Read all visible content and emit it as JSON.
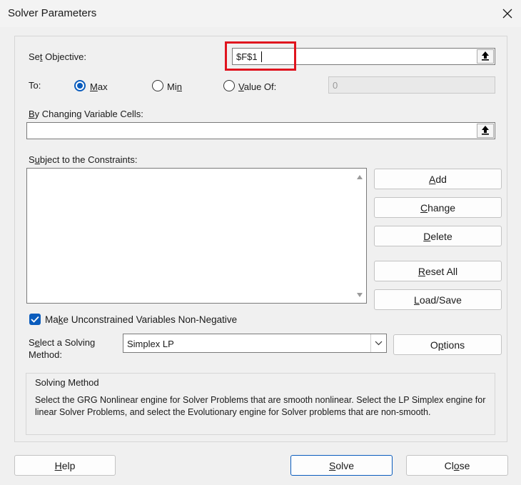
{
  "window": {
    "title": "Solver Parameters"
  },
  "objective": {
    "label": "Set Objective:",
    "value": "$F$1"
  },
  "to": {
    "label": "To:",
    "options": [
      {
        "label": "Max",
        "selected": true
      },
      {
        "label": "Min",
        "selected": false
      },
      {
        "label": "Value Of:",
        "selected": false
      }
    ],
    "value_of": "0"
  },
  "variables": {
    "label": "By Changing Variable Cells:",
    "value": ""
  },
  "constraints": {
    "label": "Subject to the Constraints:",
    "items": [],
    "buttons": {
      "add": "Add",
      "change": "Change",
      "delete": "Delete",
      "reset_all": "Reset All",
      "load_save": "Load/Save"
    }
  },
  "nonneg": {
    "label": "Make Unconstrained Variables Non-Negative",
    "checked": true
  },
  "method": {
    "label_line1": "Select a Solving",
    "label_line2": "Method:",
    "selected": "Simplex LP",
    "options_button": "Options"
  },
  "description": {
    "heading": "Solving Method",
    "text": "Select the GRG Nonlinear engine for Solver Problems that are smooth nonlinear. Select the LP Simplex engine for linear Solver Problems, and select the Evolutionary engine for Solver problems that are non-smooth."
  },
  "footer": {
    "help": "Help",
    "solve": "Solve",
    "close": "Close"
  },
  "colors": {
    "accent": "#0a5cbd",
    "highlight": "#e0141e"
  }
}
